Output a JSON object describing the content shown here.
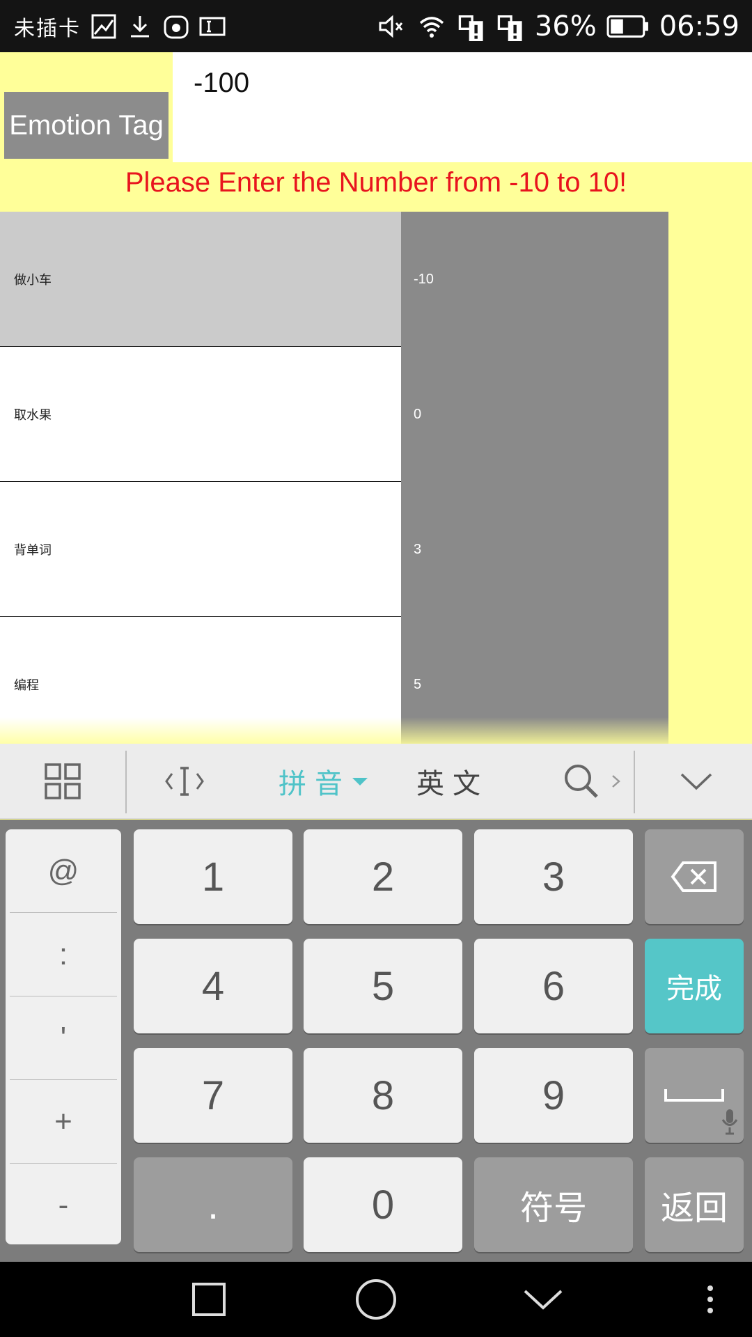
{
  "status_bar": {
    "carrier": "未插卡",
    "battery": "36%",
    "time": "06:59",
    "icons": [
      "gallery-icon",
      "download-icon",
      "huawei-icon",
      "input-icon",
      "mute-icon",
      "wifi-icon",
      "sim-alert-icon",
      "sim-alert-icon",
      "battery-icon"
    ]
  },
  "form": {
    "label": "Emotion Tag",
    "value": "-100",
    "error": "Please Enter the Number from -10 to 10!"
  },
  "table": {
    "rows": [
      {
        "name": "做小车",
        "value": "-10"
      },
      {
        "name": "取水果",
        "value": "0"
      },
      {
        "name": "背单词",
        "value": "3"
      },
      {
        "name": "编程",
        "value": "5"
      }
    ]
  },
  "keyboard": {
    "toolbar": {
      "pinyin": "拼音",
      "english": "英文"
    },
    "symbols": [
      "@",
      ":",
      "'",
      "+",
      "-"
    ],
    "keys": {
      "k1": "1",
      "k2": "2",
      "k3": "3",
      "k4": "4",
      "k5": "5",
      "k6": "6",
      "k7": "7",
      "k8": "8",
      "k9": "9",
      "dot": ".",
      "k0": "0",
      "symbol": "符号",
      "back": "返回",
      "done": "完成"
    }
  },
  "colors": {
    "background": "#ffff99",
    "error": "#e8141e",
    "accent": "#55c6c8"
  }
}
